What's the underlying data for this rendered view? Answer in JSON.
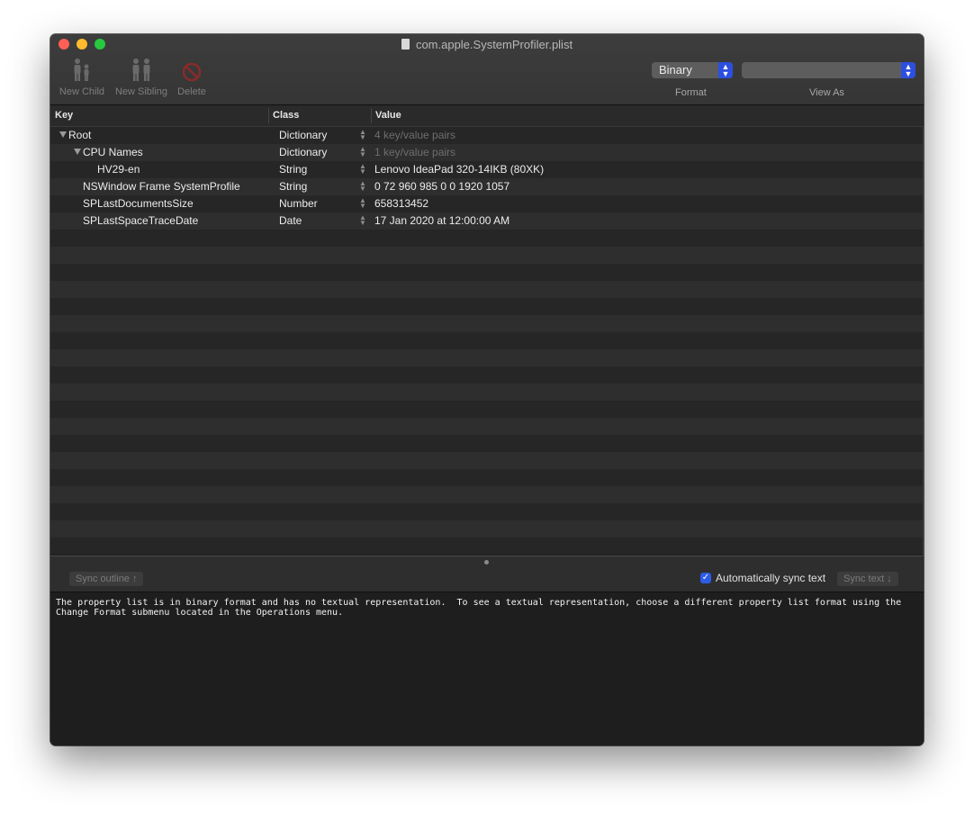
{
  "window": {
    "title": "com.apple.SystemProfiler.plist"
  },
  "toolbar": {
    "new_child": "New Child",
    "new_sibling": "New Sibling",
    "delete": "Delete",
    "format_value": "Binary",
    "format_label": "Format",
    "view_as_value": "",
    "view_as_label": "View As"
  },
  "columns": {
    "key": "Key",
    "class": "Class",
    "value": "Value"
  },
  "rows": [
    {
      "key": "Root",
      "class": "Dictionary",
      "value": "4 key/value pairs",
      "expanded": true
    },
    {
      "key": "CPU Names",
      "class": "Dictionary",
      "value": "1 key/value pairs",
      "expanded": true
    },
    {
      "key": "HV29-en",
      "class": "String",
      "value": "Lenovo IdeaPad 320-14IKB (80XK)"
    },
    {
      "key": "NSWindow Frame SystemProfile",
      "class": "String",
      "value": "0 72 960 985 0 0 1920 1057"
    },
    {
      "key": "SPLastDocumentsSize",
      "class": "Number",
      "value": "658313452"
    },
    {
      "key": "SPLastSpaceTraceDate",
      "class": "Date",
      "value": "17 Jan 2020 at 12:00:00 AM"
    }
  ],
  "bottom": {
    "sync_outline": "Sync outline ↑",
    "auto_sync_label": "Automatically sync text",
    "auto_sync_checked": true,
    "sync_text": "Sync text ↓",
    "text_content": "The property list is in binary format and has no textual representation.  To see a textual representation, choose a different property list format using the\nChange Format submenu located in the Operations menu."
  },
  "colors": {
    "accent": "#2d5ce6",
    "close": "#fd5f57",
    "minimize": "#febc2e",
    "maximize": "#27c840"
  }
}
